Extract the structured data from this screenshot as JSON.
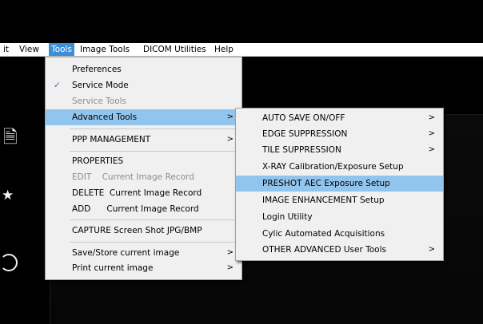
{
  "menubar": {
    "items": [
      "it",
      "View",
      "Tools",
      "Image Tools",
      "DICOM Utilities",
      "Help"
    ]
  },
  "tools_menu": {
    "items": [
      {
        "label": "Preferences"
      },
      {
        "label": "Service Mode"
      },
      {
        "label": "Service Tools"
      },
      {
        "label": "Advanced Tools",
        "arrow": ">"
      },
      {
        "label": "PPP MANAGEMENT",
        "arrow": ">"
      },
      {
        "label": "PROPERTIES"
      },
      {
        "label": "EDIT    Current Image Record"
      },
      {
        "label": "DELETE  Current Image Record"
      },
      {
        "label": "ADD      Current Image Record"
      },
      {
        "label": "CAPTURE Screen Shot JPG/BMP"
      },
      {
        "label": "Save/Store current image",
        "arrow": ">"
      },
      {
        "label": "Print current image",
        "arrow": ">"
      }
    ]
  },
  "advanced_menu": {
    "items": [
      {
        "label": "AUTO SAVE ON/OFF",
        "arrow": ">"
      },
      {
        "label": "EDGE SUPPRESSION",
        "arrow": ">"
      },
      {
        "label": "TILE SUPPRESSION",
        "arrow": ">"
      },
      {
        "label": "X-RAY Calibration/Exposure Setup"
      },
      {
        "label": "PRESHOT AEC Exposure Setup"
      },
      {
        "label": "IMAGE ENHANCEMENT Setup"
      },
      {
        "label": "Login Utility"
      },
      {
        "label": "Cylic Automated Acquisitions"
      },
      {
        "label": "OTHER ADVANCED User Tools",
        "arrow": ">"
      }
    ]
  },
  "icons": {
    "check": "✓",
    "doc": "🗎",
    "star": "★"
  },
  "colors": {
    "menu_active": "#3a8fd8",
    "menu_highlight": "#92c5ee",
    "background": "#000000"
  }
}
